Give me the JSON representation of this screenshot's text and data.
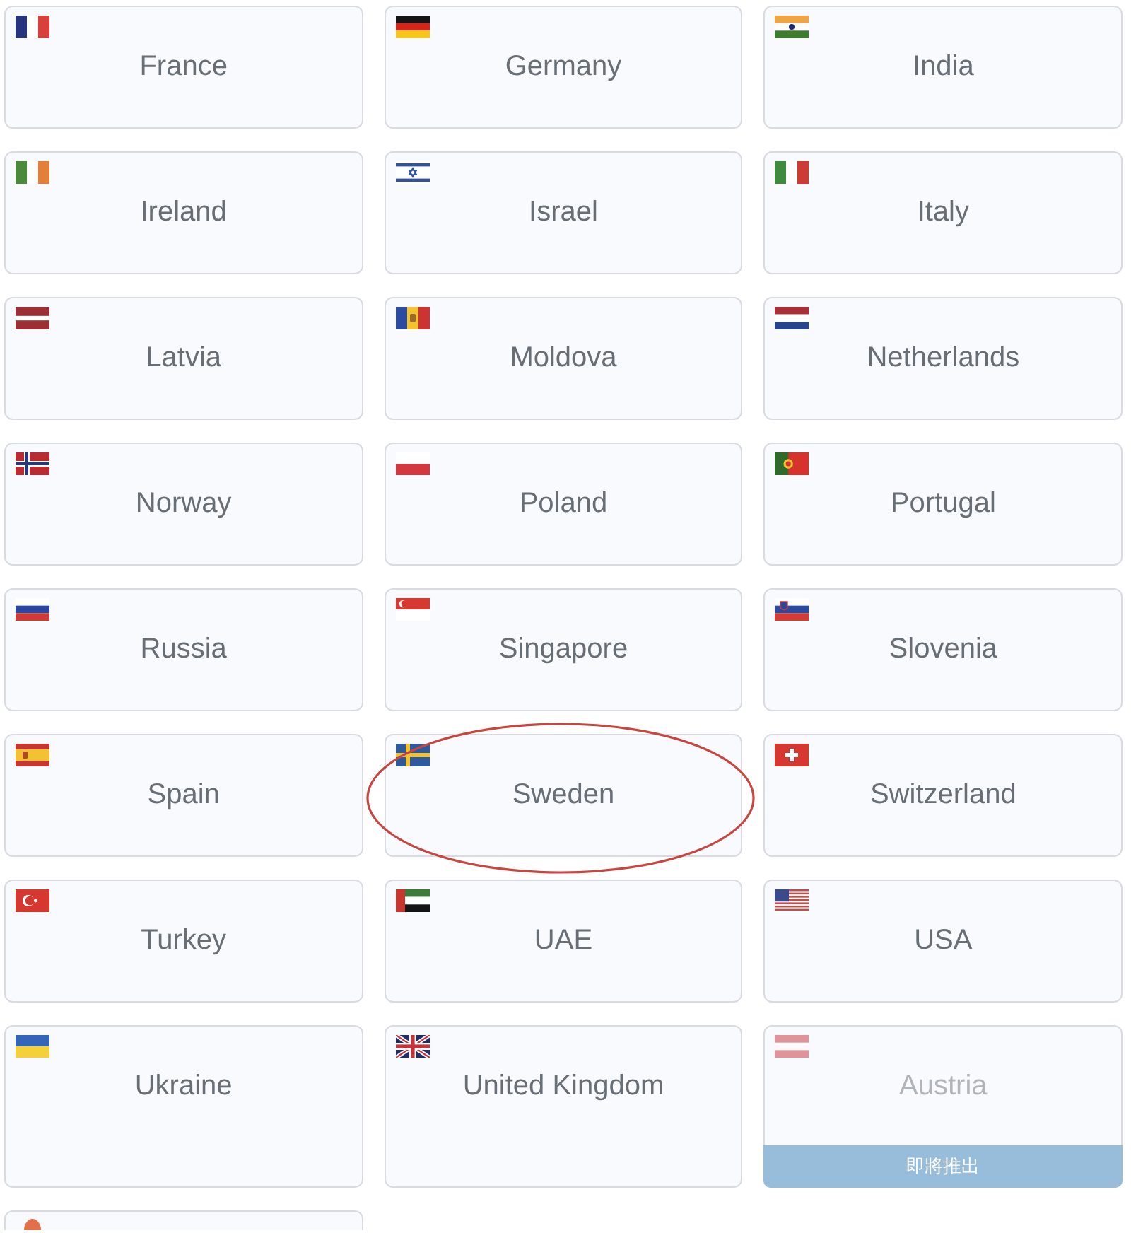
{
  "countries": [
    {
      "name": "France",
      "kind": "fr",
      "disabled": false,
      "circled": false
    },
    {
      "name": "Germany",
      "kind": "de",
      "disabled": false,
      "circled": false
    },
    {
      "name": "India",
      "kind": "in",
      "disabled": false,
      "circled": false
    },
    {
      "name": "Ireland",
      "kind": "ie",
      "disabled": false,
      "circled": false
    },
    {
      "name": "Israel",
      "kind": "il",
      "disabled": false,
      "circled": false
    },
    {
      "name": "Italy",
      "kind": "it",
      "disabled": false,
      "circled": false
    },
    {
      "name": "Latvia",
      "kind": "lv",
      "disabled": false,
      "circled": false
    },
    {
      "name": "Moldova",
      "kind": "md",
      "disabled": false,
      "circled": false
    },
    {
      "name": "Netherlands",
      "kind": "nl",
      "disabled": false,
      "circled": false
    },
    {
      "name": "Norway",
      "kind": "no",
      "disabled": false,
      "circled": false
    },
    {
      "name": "Poland",
      "kind": "pl",
      "disabled": false,
      "circled": false
    },
    {
      "name": "Portugal",
      "kind": "pt",
      "disabled": false,
      "circled": false
    },
    {
      "name": "Russia",
      "kind": "ru",
      "disabled": false,
      "circled": false
    },
    {
      "name": "Singapore",
      "kind": "sg",
      "disabled": false,
      "circled": false
    },
    {
      "name": "Slovenia",
      "kind": "si",
      "disabled": false,
      "circled": false
    },
    {
      "name": "Spain",
      "kind": "es",
      "disabled": false,
      "circled": false
    },
    {
      "name": "Sweden",
      "kind": "se",
      "disabled": false,
      "circled": true
    },
    {
      "name": "Switzerland",
      "kind": "ch",
      "disabled": false,
      "circled": false
    },
    {
      "name": "Turkey",
      "kind": "tr",
      "disabled": false,
      "circled": false
    },
    {
      "name": "UAE",
      "kind": "ae",
      "disabled": false,
      "circled": false
    },
    {
      "name": "USA",
      "kind": "us",
      "disabled": false,
      "circled": false
    },
    {
      "name": "Ukraine",
      "kind": "ua",
      "disabled": false,
      "circled": false
    },
    {
      "name": "United Kingdom",
      "kind": "gb",
      "disabled": false,
      "circled": false
    },
    {
      "name": "Austria",
      "kind": "at",
      "disabled": true,
      "circled": false,
      "note": "即將推出"
    },
    {
      "kind": "disc",
      "disabled": false,
      "circled": false
    }
  ]
}
